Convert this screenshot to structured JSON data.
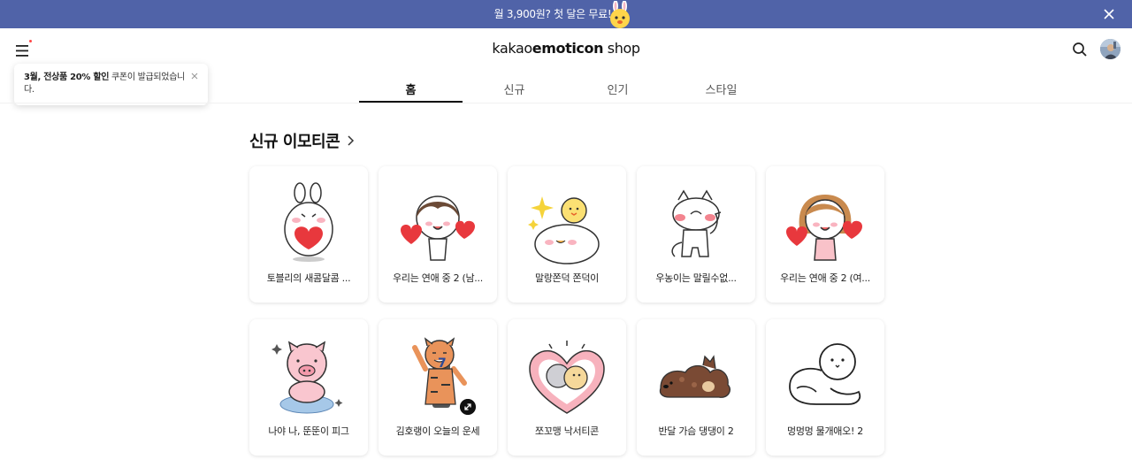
{
  "banner": {
    "text": "월 3,900원? 첫 달은 무료!",
    "mascot_icon": "bunny-mascot-icon",
    "close_icon": "close-icon",
    "background": "#5063a8"
  },
  "header": {
    "brand_light": "kakao",
    "brand_bold": "emoticon",
    "brand_suffix": " shop",
    "menu_icon": "hamburger-menu-icon",
    "search_icon": "search-icon",
    "avatar_icon": "user-avatar"
  },
  "toast": {
    "bold": "3월, 전상품 20% 할인",
    "text": " 쿠폰이 발급되었습니다.",
    "close_icon": "close-icon"
  },
  "tabs": [
    {
      "label": "홈",
      "active": true
    },
    {
      "label": "신규",
      "active": false
    },
    {
      "label": "인기",
      "active": false
    },
    {
      "label": "스타일",
      "active": false
    }
  ],
  "section": {
    "title": "신규 이모티콘",
    "arrow_icon": "chevron-right-icon"
  },
  "emoticons": [
    {
      "title": "토블리의 새콤달콤 ...",
      "icon": "bunny-heart-sticker"
    },
    {
      "title": "우리는 연애 중 2 (남...",
      "icon": "boy-hearts-sticker"
    },
    {
      "title": "말랑쫀덕 쫀덕이",
      "icon": "seal-chick-sticker"
    },
    {
      "title": "우농이는 말릴수없...",
      "icon": "cat-thumbsup-sticker"
    },
    {
      "title": "우리는 연애 중 2 (여...",
      "icon": "girl-hearts-sticker"
    },
    {
      "title": "나야 나, 뚠뚠이 피그",
      "icon": "pig-sticker"
    },
    {
      "title": "김호랭이 오늘의 운세",
      "icon": "tiger-sticker",
      "animated": true
    },
    {
      "title": "쪼꼬맹 낙서티콘",
      "icon": "heart-couple-sticker"
    },
    {
      "title": "반달 가슴 댕댕이 2",
      "icon": "puppy-sticker"
    },
    {
      "title": "멍멍멍 물개애오! 2",
      "icon": "seal-outline-sticker"
    }
  ]
}
